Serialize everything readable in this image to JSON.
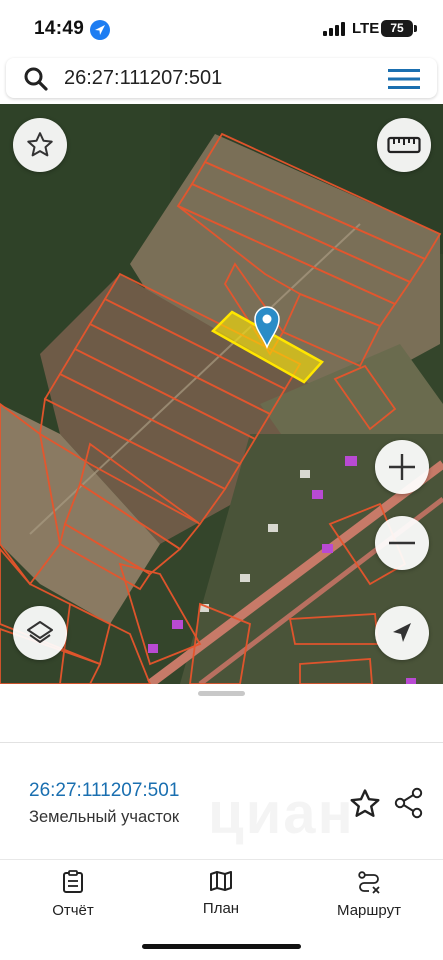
{
  "status": {
    "time": "14:49",
    "network": "LTE",
    "battery": "75"
  },
  "search": {
    "query": "26:27:111207:501"
  },
  "map": {
    "buttons": {
      "favorite": "star-icon",
      "ruler": "ruler-icon",
      "layers": "layers-icon",
      "zoom_in": "plus-icon",
      "zoom_out": "minus-icon",
      "locate": "navigation-arrow-icon"
    },
    "colors": {
      "parcel_outline": "#e8552c",
      "selected_parcel": "#ffe600",
      "pin": "#2a8cc7"
    }
  },
  "parcel": {
    "number": "26:27:111207:501",
    "type": "Земельный участок",
    "watermark": "циан"
  },
  "tabs": [
    {
      "label": "Отчёт",
      "icon": "report-icon"
    },
    {
      "label": "План",
      "icon": "map-plan-icon"
    },
    {
      "label": "Маршрут",
      "icon": "route-icon"
    }
  ],
  "accent_color": "#1a6fb0"
}
